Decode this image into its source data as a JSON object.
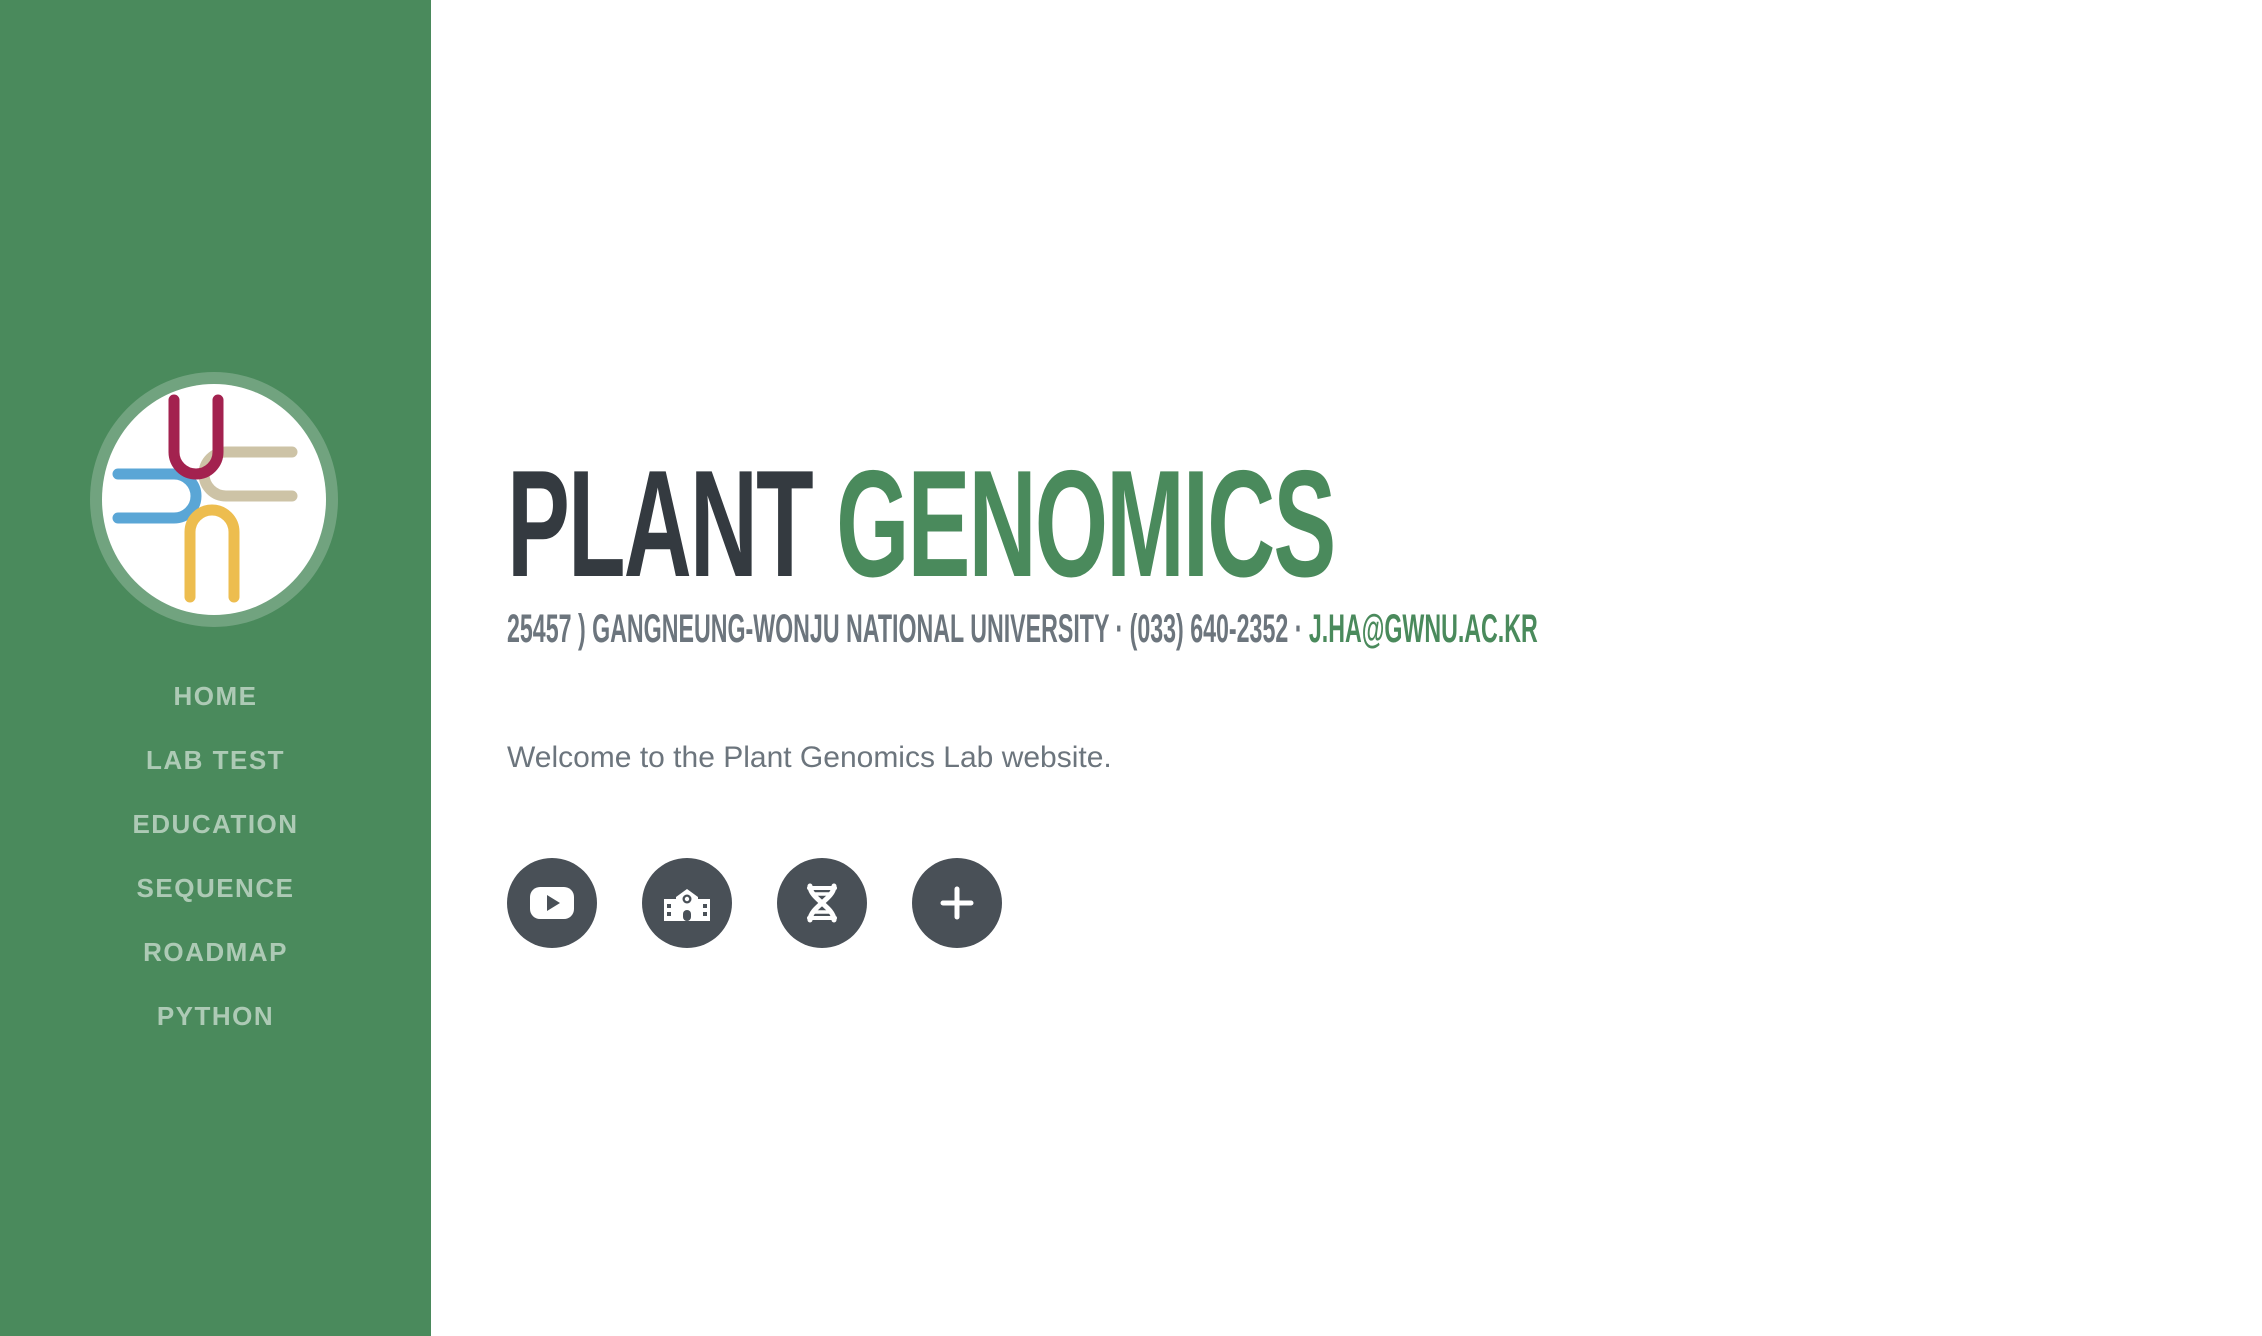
{
  "theme": {
    "accent": "#4a8a5c",
    "sidebar_bg": "#4a8a5c",
    "dark_text": "#343a40",
    "muted_text": "#6c757d",
    "icon_bg": "#495057"
  },
  "sidebar": {
    "logo_icon": "lab-monogram-logo",
    "nav": [
      {
        "label": "HOME"
      },
      {
        "label": "LAB TEST"
      },
      {
        "label": "EDUCATION"
      },
      {
        "label": "SEQUENCE"
      },
      {
        "label": "ROADMAP"
      },
      {
        "label": "PYTHON"
      }
    ]
  },
  "main": {
    "title_part1": "PLANT",
    "title_part2": "GENOMICS",
    "address": "25457 ) GANGNEUNG-WONJU NATIONAL UNIVERSITY · (033) 640-2352 ·",
    "email": "J.HA@GWNU.AC.KR",
    "lead": "Welcome to the Plant Genomics Lab website.",
    "social": [
      {
        "icon": "youtube-icon"
      },
      {
        "icon": "school-icon"
      },
      {
        "icon": "dna-icon"
      },
      {
        "icon": "plus-icon"
      }
    ]
  }
}
